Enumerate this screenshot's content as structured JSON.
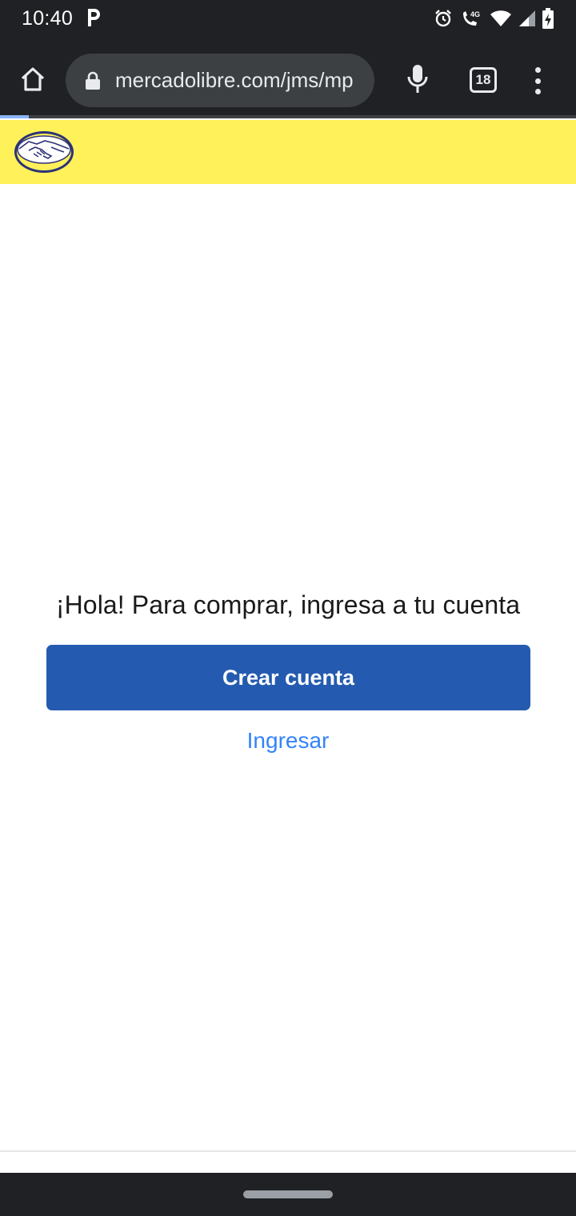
{
  "status_bar": {
    "time": "10:40",
    "icons": [
      "parking-icon",
      "alarm-icon",
      "wifi-calling-icon",
      "wifi-icon",
      "cellular-signal-icon",
      "battery-charging-icon"
    ],
    "network_label": "4G"
  },
  "browser": {
    "url": "mercadolibre.com/jms/mp",
    "tab_count": "18",
    "load_progress": 0.05,
    "icons": [
      "home-icon",
      "lock-icon",
      "mic-icon",
      "tabs-icon",
      "more-vert-icon"
    ]
  },
  "site": {
    "header_color": "#fff159",
    "logo": "mercado-libre-handshake-logo"
  },
  "main": {
    "headline": "¡Hola! Para comprar, ingresa a tu cuenta",
    "create_account_button": "Crear cuenta",
    "login_link": "Ingresar"
  },
  "colors": {
    "primary_button": "#245bb0",
    "link": "#3483fa",
    "system_bars": "#202124"
  }
}
